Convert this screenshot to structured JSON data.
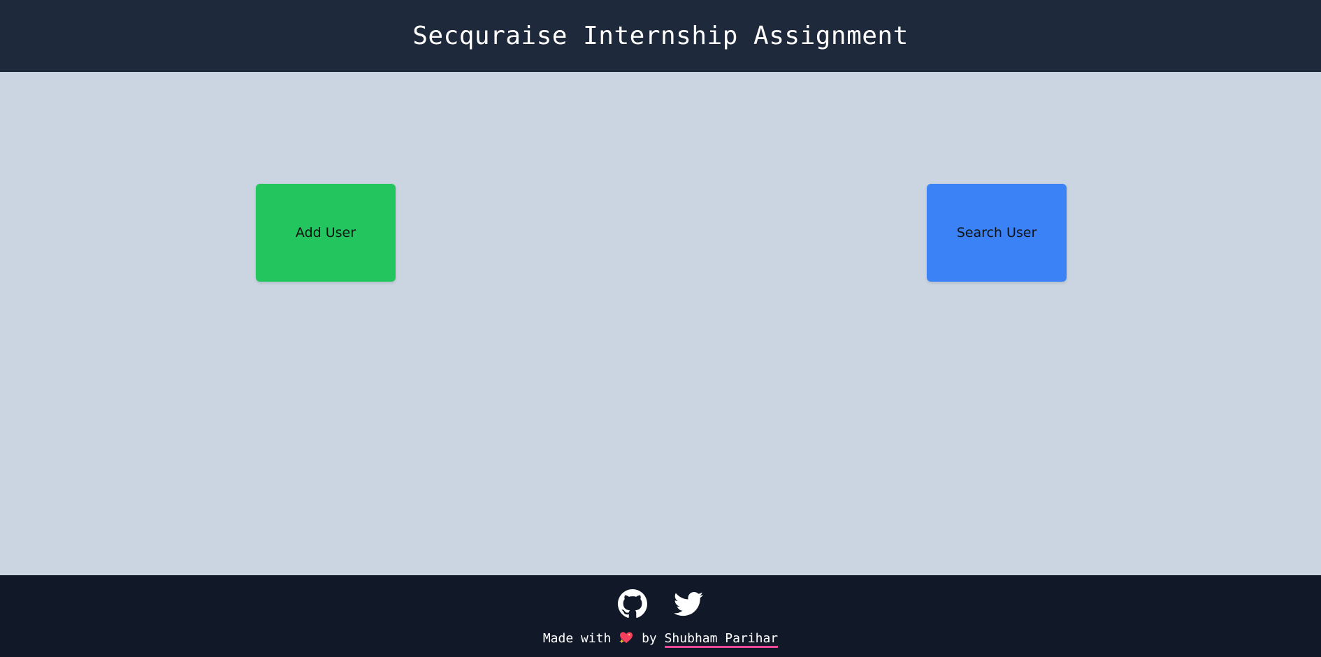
{
  "header": {
    "title": "Secquraise Internship Assignment"
  },
  "main": {
    "add_user_label": "Add User",
    "search_user_label": "Search User"
  },
  "footer": {
    "icons": [
      "github-icon",
      "twitter-icon"
    ],
    "made_with": "Made with",
    "by": "by",
    "author": "Shubham Parihar"
  },
  "colors": {
    "header_bg": "#1e293b",
    "main_bg": "#cbd5e1",
    "footer_bg": "#111827",
    "add_button": "#22c55e",
    "search_button": "#3b82f6",
    "author_underline": "#ec4899"
  }
}
